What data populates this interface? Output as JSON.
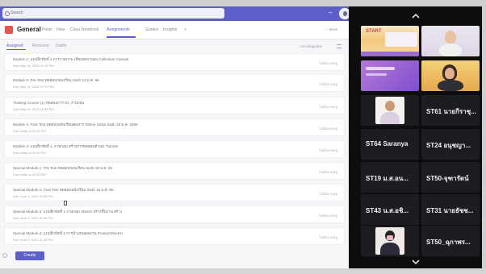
{
  "search": {
    "placeholder": "Search"
  },
  "header": {
    "channel": "General",
    "tabs": [
      "Posts",
      "Files",
      "Class Notebook",
      "Assignments",
      "Grades",
      "Insights",
      "+"
    ],
    "active_tab": "Assignments",
    "more": "⋯ More"
  },
  "subtabs": {
    "items": [
      "Assigned",
      "Returned",
      "Drafts"
    ],
    "active": "Assigned",
    "category_filter": "All categories"
  },
  "assignments": [
    {
      "title": "Module 1: แบบฝึกหัดที่ 1 การวาดภาพ เทียบตอง Data Collection Canvas",
      "due": "Due May 18, 2022 11:59 PM",
      "category": "ไม่มีหมวดหมู่"
    },
    {
      "title": "Module 0: Pre Test ทดสอบก่อนเรียน Sixth 13 ม.ค. 65",
      "due": "Due May 18, 2022 11:59 PM",
      "category": "ไม่มีหมวดหมู่"
    },
    {
      "title": "Training Course (1) ทดสอบการ 01: งานกลุ่ม",
      "due": "Due May 09, 2022 11:59 PM",
      "category": "ไม่มีหมวดหมู่"
    },
    {
      "title": "Module 4: Post Test ทดสอบหลังเรียนคมสาร Online Class Sixth 18 ม.ค. 2565",
      "due": "Due today at 11:59 PM",
      "category": "ไม่มีหมวดหมู่"
    },
    {
      "title": "Module 4: แบบฝึกหัดที่ 1: งานกลุ่ม สร้างการทดสอบตัวเอง Tutorial",
      "due": "Due today at 11:59 PM",
      "category": "ไม่มีหมวดหมู่"
    },
    {
      "title": "Special Module 1: Pre Test ทดสอบก่อนเรียน Sixth 18 ม.ค. 65",
      "due": "Due today at 11:59 PM",
      "category": "ไม่มีหมวดหมู่"
    },
    {
      "title": "Special Module 2: Post Test ทดสอบหลังเรียน Sixth 18 ม.ค. 65",
      "due": "Due June 3, 2022 11:59 PM",
      "category": "ไม่มีหมวดหมู่"
    },
    {
      "title": "Special Module 2: แบบฝึกหัดที่ 1 งานกลุ่ม Sketch สร้างชิ้นงาน สร้าง",
      "due": "Due June 3, 2022 11:59 PM",
      "category": "ไม่มีหมวดหมู่"
    },
    {
      "title": "Special Module 2: แบบฝึกหัดที่ 2 การนำเสนอผลงาน Product/Sketch",
      "due": "Due June 3, 2022 11:59 PM",
      "category": "ไม่มีหมวดหมู่"
    }
  ],
  "actions": {
    "create": "Create"
  },
  "participants": {
    "labels": [
      "ST61 นายกีราชุ...",
      "ST64 Saranya",
      "ST24 อนุชญา...",
      "ST19 ม.ส.อน...",
      "ST50-จุฑารัตน์",
      "ST43 น.ส.อชิ...",
      "ST31 นายธัชช...",
      "ST50_ฉุกาพร..."
    ]
  },
  "slide": {
    "text": "START"
  },
  "colors": {
    "teams_purple": "#5b5fc7",
    "panel_bg": "#0d0d10",
    "tile_bg": "#1c1c21",
    "logo_red": "#e9524a"
  }
}
